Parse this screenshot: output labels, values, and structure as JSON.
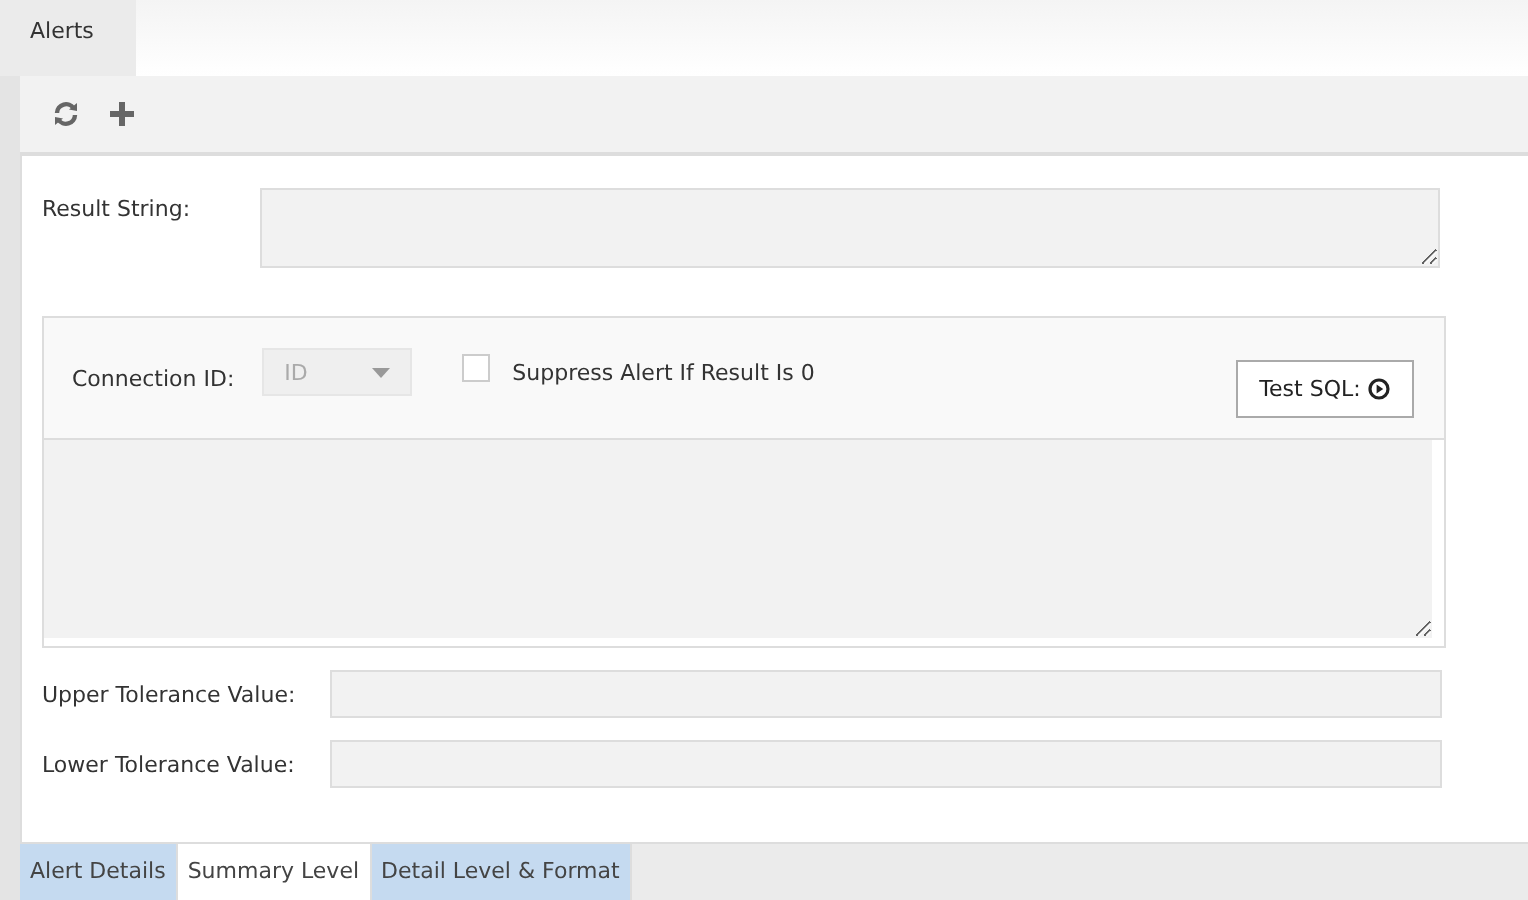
{
  "top_tabs": [
    {
      "label": "Alerts",
      "selected": true
    }
  ],
  "toolbar": {
    "buttons": [
      {
        "kind": "refresh"
      },
      {
        "kind": "add"
      }
    ]
  },
  "result_string": {
    "label": "Result String:"
  },
  "sql": {
    "connection_label": "Connection ID:",
    "connection_value": "ID",
    "connection_disabled": true,
    "suppress_label": "Suppress Alert If Result Is 0",
    "suppress_checked": false,
    "test_button": "Test SQL:"
  },
  "tolerances": [
    {
      "label": "Upper Tolerance Value:"
    },
    {
      "label": "Lower Tolerance Value:"
    }
  ],
  "bottom_tabs": [
    {
      "label": "Alert Details",
      "selected": false
    },
    {
      "label": "Summary Level",
      "selected": true
    },
    {
      "label": "Detail Level & Format",
      "selected": false
    }
  ]
}
